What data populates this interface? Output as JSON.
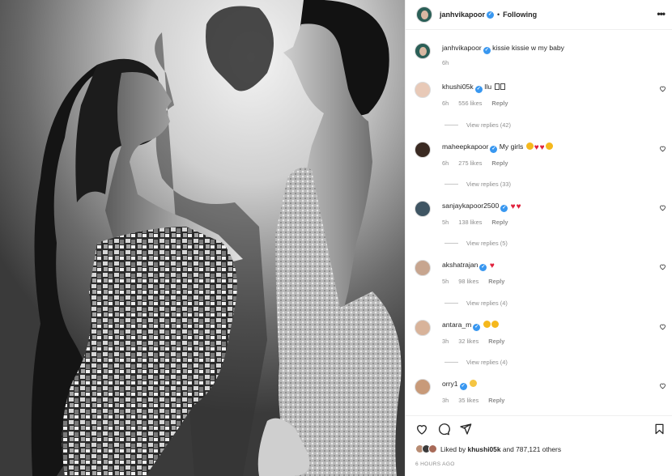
{
  "post": {
    "author": "janhvikapoor",
    "separator": "•",
    "follow_status": "Following",
    "more_label": "•••",
    "caption": "kissie kissie w my baby",
    "caption_age": "6h"
  },
  "comments": [
    {
      "user": "khushi05k",
      "verified": true,
      "text": "Ilu ",
      "emojis": [
        "box",
        "box"
      ],
      "age": "6h",
      "likes": "556 likes",
      "reply": "Reply",
      "view_replies": "View replies (42)"
    },
    {
      "user": "maheepkapoor",
      "verified": true,
      "text": "My girls ",
      "emojis": [
        "star-eyes",
        "heart",
        "heart",
        "star-eyes"
      ],
      "age": "6h",
      "likes": "275 likes",
      "reply": "Reply",
      "view_replies": "View replies (33)"
    },
    {
      "user": "sanjaykapoor2500",
      "verified": true,
      "text": "",
      "emojis": [
        "heart",
        "heart"
      ],
      "age": "5h",
      "likes": "138 likes",
      "reply": "Reply",
      "view_replies": "View replies (5)"
    },
    {
      "user": "akshatrajan",
      "verified": true,
      "text": "",
      "emojis": [
        "heart"
      ],
      "age": "5h",
      "likes": "98 likes",
      "reply": "Reply",
      "view_replies": "View replies (4)"
    },
    {
      "user": "antara_m",
      "verified": true,
      "text": "",
      "emojis": [
        "star-eyes",
        "star-eyes"
      ],
      "age": "3h",
      "likes": "32 likes",
      "reply": "Reply",
      "view_replies": "View replies (4)"
    },
    {
      "user": "orry1",
      "verified": true,
      "text": "",
      "emojis": [
        "smile"
      ],
      "age": "3h",
      "likes": "35 likes",
      "reply": "Reply",
      "view_replies": ""
    }
  ],
  "likes_summary": {
    "prefix": "Liked by ",
    "user": "khushi05k",
    "suffix": " and 787,121 others"
  },
  "timestamp": "6 HOURS AGO",
  "colors": {
    "verified": "#3897f0",
    "heart": "#e0203b",
    "secondary_text": "#8e8e8e"
  }
}
